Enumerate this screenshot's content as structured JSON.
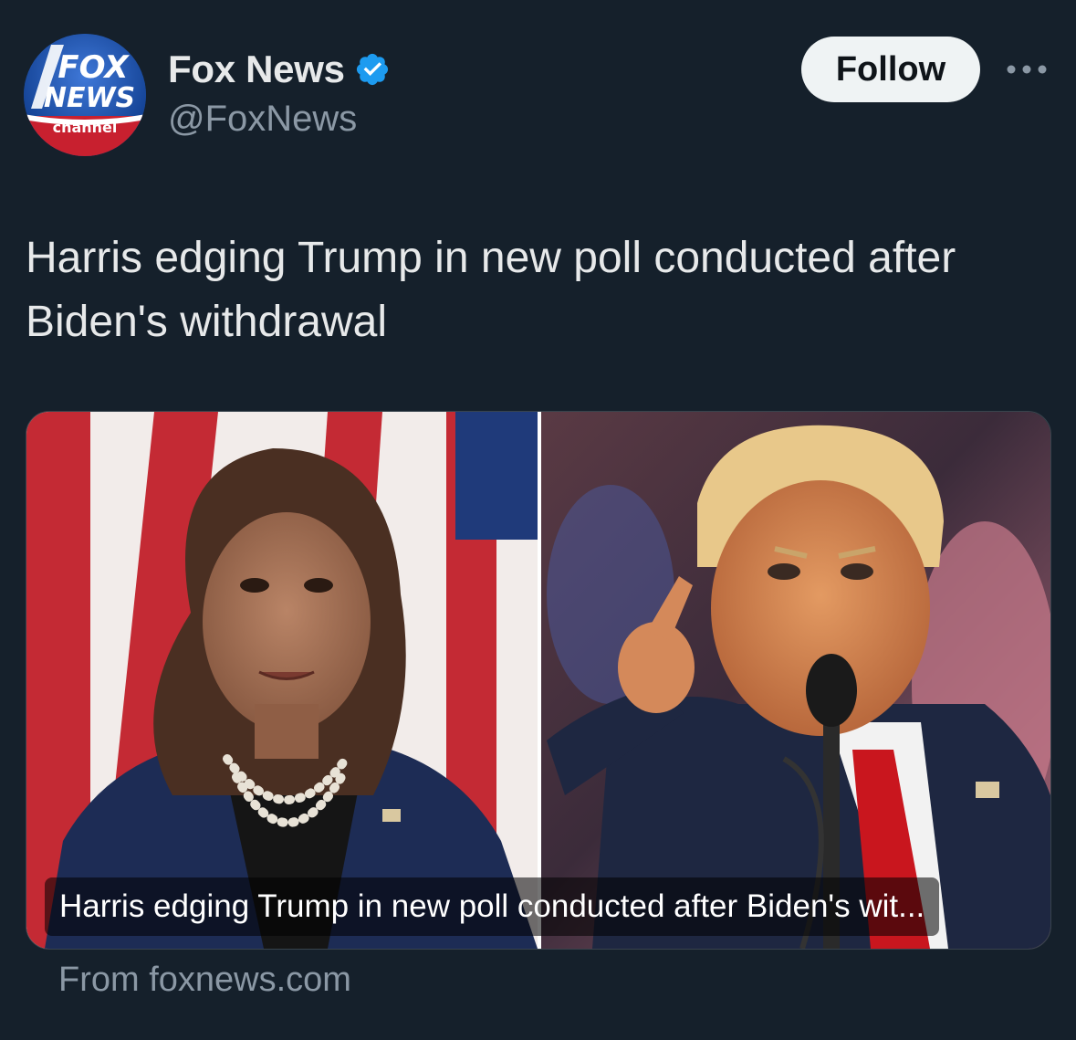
{
  "account": {
    "display_name": "Fox News",
    "handle": "@FoxNews",
    "avatar_logo": {
      "line1": "FOX",
      "line2": "NEWS",
      "line3": "channel"
    },
    "verified_icon": "verified-badge-icon"
  },
  "actions": {
    "follow_label": "Follow",
    "more_icon": "more-horizontal-icon"
  },
  "tweet": {
    "text": "Harris edging Trump in new poll conducted after Biden's withdrawal"
  },
  "link_card": {
    "image": "split photo: Kamala Harris (left) and Donald Trump (right)",
    "caption": "Harris edging Trump in new poll conducted after Biden's wit...",
    "source": "From foxnews.com"
  },
  "colors": {
    "background": "#15202b",
    "text": "#e7e9ea",
    "secondary_text": "#8b98a5",
    "verified_blue": "#1d9bf0",
    "follow_bg": "#eff3f4"
  }
}
